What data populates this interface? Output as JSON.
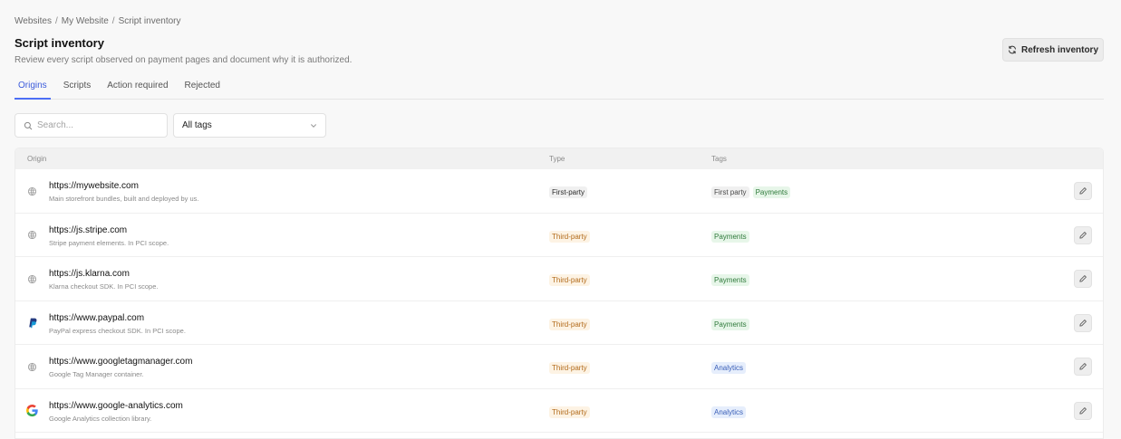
{
  "breadcrumb": [
    "Websites",
    "My Website",
    "Script inventory"
  ],
  "breadcrumb_separator": "/",
  "header": {
    "title": "Script inventory",
    "description": "Review every script observed on payment pages and document why it is authorized.",
    "refresh_label": "Refresh inventory"
  },
  "tabs": [
    {
      "label": "Origins",
      "active": true
    },
    {
      "label": "Scripts",
      "active": false
    },
    {
      "label": "Action required",
      "active": false
    },
    {
      "label": "Rejected",
      "active": false
    }
  ],
  "filters": {
    "search_placeholder": "Search...",
    "search_value": "",
    "tag_selected": "All tags"
  },
  "table": {
    "columns": [
      "Origin",
      "Type",
      "Tags"
    ],
    "rows": [
      {
        "origin": "https://mywebsite.com",
        "description": "Main storefront bundles, built and deployed by us.",
        "icon": "globe-icon",
        "type": "First-party",
        "type_style": "first",
        "tags": [
          {
            "label": "First party",
            "style": "neutral"
          },
          {
            "label": "Payments",
            "style": "green"
          }
        ]
      },
      {
        "origin": "https://js.stripe.com",
        "description": "Stripe payment elements. In PCI scope.",
        "icon": "globe-icon",
        "type": "Third-party",
        "type_style": "third",
        "tags": [
          {
            "label": "Payments",
            "style": "green"
          }
        ]
      },
      {
        "origin": "https://js.klarna.com",
        "description": "Klarna checkout SDK. In PCI scope.",
        "icon": "globe-icon",
        "type": "Third-party",
        "type_style": "third",
        "tags": [
          {
            "label": "Payments",
            "style": "green"
          }
        ]
      },
      {
        "origin": "https://www.paypal.com",
        "description": "PayPal express checkout SDK. In PCI scope.",
        "icon": "paypal-logo-icon",
        "type": "Third-party",
        "type_style": "third",
        "tags": [
          {
            "label": "Payments",
            "style": "green"
          }
        ]
      },
      {
        "origin": "https://www.googletagmanager.com",
        "description": "Google Tag Manager container.",
        "icon": "globe-icon",
        "type": "Third-party",
        "type_style": "third",
        "tags": [
          {
            "label": "Analytics",
            "style": "blue"
          }
        ]
      },
      {
        "origin": "https://www.google-analytics.com",
        "description": "Google Analytics collection library.",
        "icon": "google-logo-icon",
        "type": "Third-party",
        "type_style": "third",
        "tags": [
          {
            "label": "Analytics",
            "style": "blue"
          }
        ]
      }
    ]
  },
  "colors": {
    "accent": "#4c6ef5",
    "third_party_text": "#b26a1a",
    "payments_tag": "#2f7a3b",
    "analytics_tag": "#3a5fb8"
  }
}
